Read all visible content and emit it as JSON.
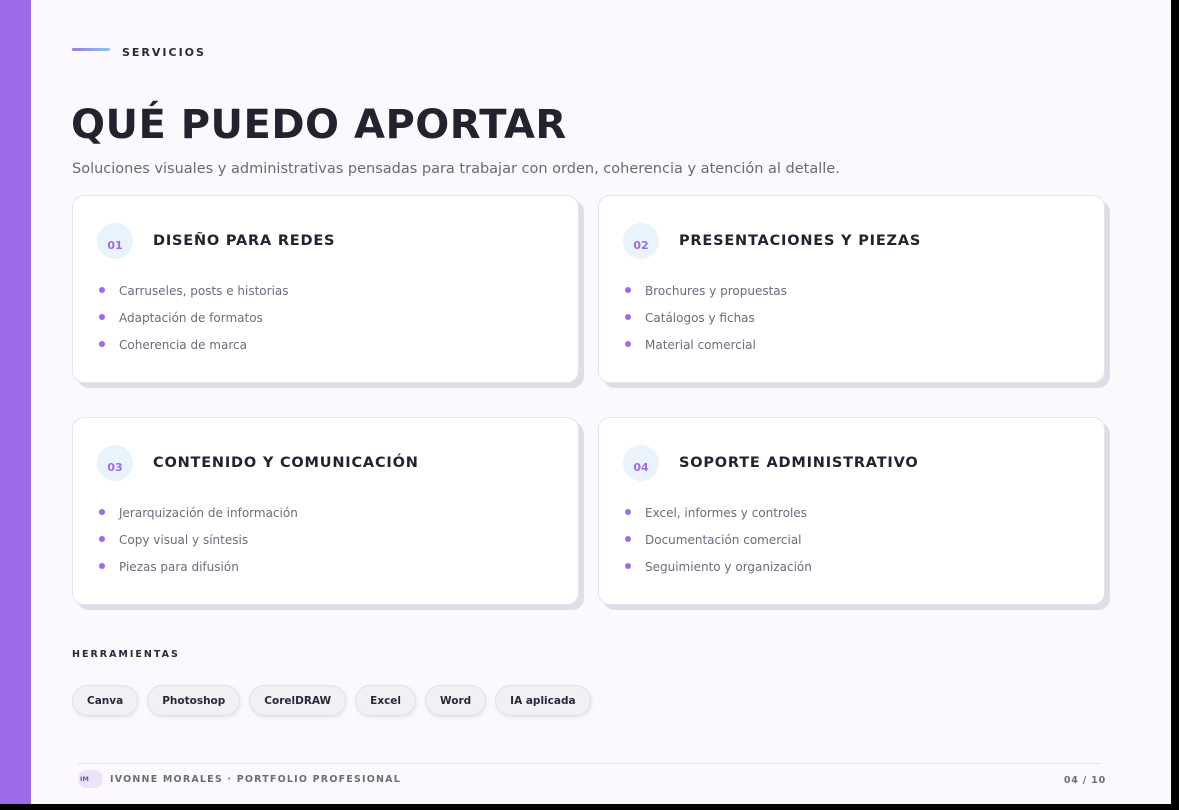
{
  "eyebrow": "SERVICIOS",
  "title": "QUÉ PUEDO APORTAR",
  "subtitle": "Soluciones visuales y administrativas pensadas para trabajar con orden, coherencia y atención al detalle.",
  "colors": {
    "accent": "#9b6bea",
    "background": "#fbf9fd",
    "text": "#25222f"
  },
  "cards": [
    {
      "number": "01",
      "title": "DISEÑO PARA REDES",
      "items": [
        "Carruseles, posts e historias",
        "Adaptación de formatos",
        "Coherencia de marca"
      ]
    },
    {
      "number": "02",
      "title": "PRESENTACIONES Y PIEZAS",
      "items": [
        "Brochures y propuestas",
        "Catálogos y fichas",
        "Material comercial"
      ]
    },
    {
      "number": "03",
      "title": "CONTENIDO Y COMUNICACIÓN",
      "items": [
        "Jerarquización de información",
        "Copy visual y síntesis",
        "Piezas para difusión"
      ]
    },
    {
      "number": "04",
      "title": "SOPORTE ADMINISTRATIVO",
      "items": [
        "Excel, informes y controles",
        "Documentación comercial",
        "Seguimiento y organización"
      ]
    }
  ],
  "tools": {
    "label": "HERRAMIENTAS",
    "items": [
      "Canva",
      "Photoshop",
      "CorelDRAW",
      "Excel",
      "Word",
      "IA aplicada"
    ]
  },
  "footer": {
    "badge": "IM",
    "text": "IVONNE MORALES · PORTFOLIO PROFESIONAL",
    "page": "04 / 10"
  }
}
